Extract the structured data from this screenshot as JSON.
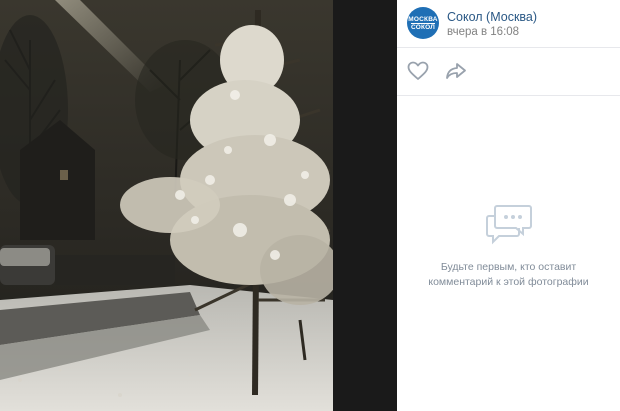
{
  "viewer": {
    "photo_alt": "",
    "author": {
      "name": "Сокол (Москва)",
      "avatar_text_top": "МОСКВА",
      "avatar_text_bottom": "СОКОЛ"
    },
    "time": "вчера в 16:08",
    "actions": {
      "like_icon": "heart-icon",
      "share_icon": "share-arrow-icon"
    },
    "comments": {
      "empty_icon": "chat-bubbles-icon",
      "empty_text": "Будьте первым, кто оставит комментарий к этой фотографии"
    }
  },
  "colors": {
    "link": "#2a5885",
    "muted": "#828282",
    "empty_text": "#818c99",
    "divider": "#e7e8ec",
    "avatar_bg": "#1f6fb5"
  }
}
